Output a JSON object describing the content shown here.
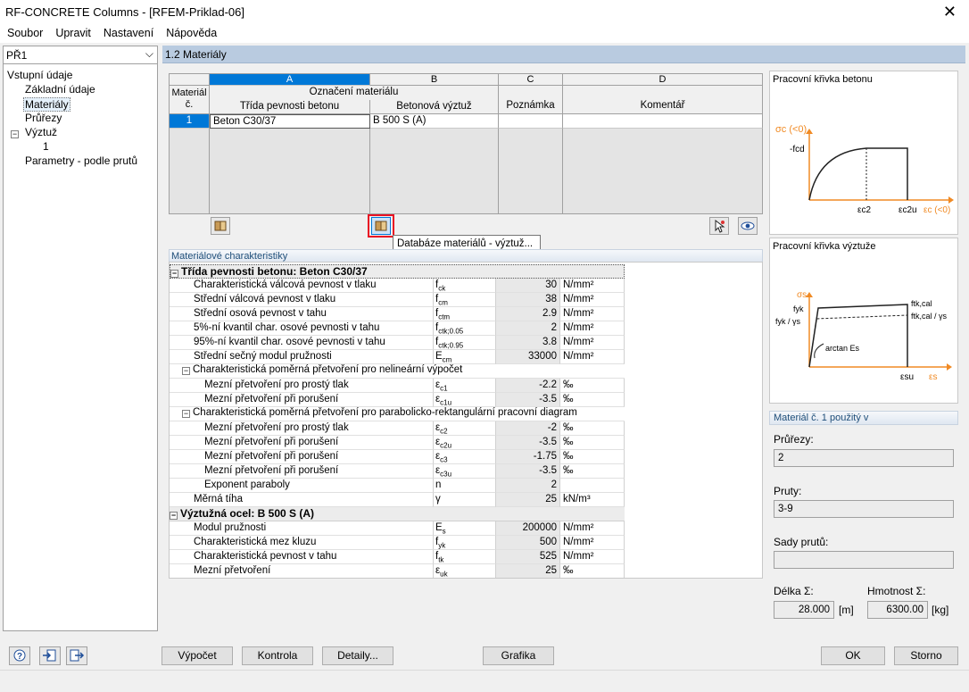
{
  "window": {
    "title": "RF-CONCRETE Columns - [RFEM-Priklad-06]",
    "close": "✕"
  },
  "menu": [
    "Soubor",
    "Upravit",
    "Nastavení",
    "Nápověda"
  ],
  "case_selector": {
    "value": "PŘ1"
  },
  "tree": {
    "root": "Vstupní údaje",
    "items": [
      "Základní údaje",
      "Materiály",
      "Průřezy",
      "Výztuž",
      "1",
      "Parametry - podle prutů"
    ]
  },
  "section_title": "1.2 Materiály",
  "table": {
    "columns": [
      "A",
      "B",
      "C",
      "D"
    ],
    "hdr_material": "Materiál\nč.",
    "hdr_material_l1": "Materiál",
    "hdr_material_l2": "č.",
    "hdr_group": "Označení materiálu",
    "hdr_concrete": "Třída pevnosti betonu",
    "hdr_rebar": "Betonová výztuž",
    "hdr_note": "Poznámka",
    "hdr_comment": "Komentář",
    "rows": [
      {
        "no": "1",
        "concrete": "Beton C30/37",
        "rebar": "B 500 S (A)",
        "note": "",
        "comment": ""
      }
    ]
  },
  "tooltip": "Databáze materiálů - výztuž...",
  "props": {
    "title": "Materiálové charakteristiky",
    "sec1": "Třída pevnosti betonu: Beton C30/37",
    "r1": {
      "name": "Charakteristická válcová pevnost v tlaku",
      "sym": "f",
      "sub": "ck",
      "val": "30",
      "unit": "N/mm²"
    },
    "r2": {
      "name": "Střední válcová pevnost v tlaku",
      "sym": "f",
      "sub": "cm",
      "val": "38",
      "unit": "N/mm²"
    },
    "r3": {
      "name": "Střední osová pevnost v tahu",
      "sym": "f",
      "sub": "ctm",
      "val": "2.9",
      "unit": "N/mm²"
    },
    "r4": {
      "name": "5%-ní kvantil char. osové pevnosti v tahu",
      "sym": "f",
      "sub": "ctk;0.05",
      "val": "2",
      "unit": "N/mm²"
    },
    "r5": {
      "name": "95%-ní kvantil char. osové pevnosti v tahu",
      "sym": "f",
      "sub": "ctk;0.95",
      "val": "3.8",
      "unit": "N/mm²"
    },
    "r6": {
      "name": "Střední sečný modul pružnosti",
      "sym": "E",
      "sub": "cm",
      "val": "33000",
      "unit": "N/mm²"
    },
    "sub1": "Charakteristická poměrná přetvoření pro nelineární výpočet",
    "r7": {
      "name": "Mezní přetvoření pro prostý tlak",
      "sym": "ε",
      "sub": "c1",
      "val": "-2.2",
      "unit": "‰"
    },
    "r8": {
      "name": "Mezní přetvoření při porušení",
      "sym": "ε",
      "sub": "c1u",
      "val": "-3.5",
      "unit": "‰"
    },
    "sub2": "Charakteristická poměrná přetvoření pro parabolicko-rektangulární pracovní diagram",
    "r9": {
      "name": "Mezní přetvoření pro prostý tlak",
      "sym": "ε",
      "sub": "c2",
      "val": "-2",
      "unit": "‰"
    },
    "r10": {
      "name": "Mezní přetvoření při porušení",
      "sym": "ε",
      "sub": "c2u",
      "val": "-3.5",
      "unit": "‰"
    },
    "r11": {
      "name": "Mezní přetvoření při porušení",
      "sym": "ε",
      "sub": "c3",
      "val": "-1.75",
      "unit": "‰"
    },
    "r12": {
      "name": "Mezní přetvoření při porušení",
      "sym": "ε",
      "sub": "c3u",
      "val": "-3.5",
      "unit": "‰"
    },
    "r13": {
      "name": "Exponent paraboly",
      "sym": "n",
      "sub": "",
      "val": "2",
      "unit": ""
    },
    "r14": {
      "name": "Měrná tíha",
      "sym": "γ",
      "sub": "",
      "val": "25",
      "unit": "kN/m³"
    },
    "sec2": "Výztužná ocel: B 500 S (A)",
    "r15": {
      "name": "Modul pružnosti",
      "sym": "E",
      "sub": "s",
      "val": "200000",
      "unit": "N/mm²"
    },
    "r16": {
      "name": "Charakteristická mez kluzu",
      "sym": "f",
      "sub": "yk",
      "val": "500",
      "unit": "N/mm²"
    },
    "r17": {
      "name": "Charakteristická pevnost v tahu",
      "sym": "f",
      "sub": "tk",
      "val": "525",
      "unit": "N/mm²"
    },
    "r18": {
      "name": "Mezní přetvoření",
      "sym": "ε",
      "sub": "uk",
      "val": "25",
      "unit": "‰"
    }
  },
  "diag1": {
    "title": "Pracovní křivka betonu",
    "y": "σc (<0)",
    "fcd": "-fcd",
    "ec2": "εc2",
    "ec2u": "εc2u",
    "x": "εc (<0)"
  },
  "diag2": {
    "title": "Pracovní křivka výztuže",
    "y": "σs",
    "fyk": "fyk",
    "fykg": "fyk / γs",
    "ftk": "ftk,cal",
    "ftkg": "ftk,cal / γs",
    "arctan": "arctan Es",
    "esu": "εsu",
    "x": "εs"
  },
  "usage": {
    "title": "Materiál č. 1 použitý v",
    "sections_label": "Průřezy:",
    "sections_value": "2",
    "members_label": "Pruty:",
    "members_value": "3-9",
    "sets_label": "Sady prutů:",
    "sets_value": "",
    "length_label": "Délka Σ:",
    "length_value": "28.000",
    "length_unit": "[m]",
    "mass_label": "Hmotnost Σ:",
    "mass_value": "6300.00",
    "mass_unit": "[kg]"
  },
  "buttons": {
    "calc": "Výpočet",
    "check": "Kontrola",
    "details": "Detaily...",
    "graphics": "Grafika",
    "ok": "OK",
    "cancel": "Storno"
  },
  "colors": {
    "header_bar": "#b9cbe0",
    "selected_col": "#0078d7",
    "highlight_box": "#e81123",
    "axis_orange": "#f08a24"
  }
}
